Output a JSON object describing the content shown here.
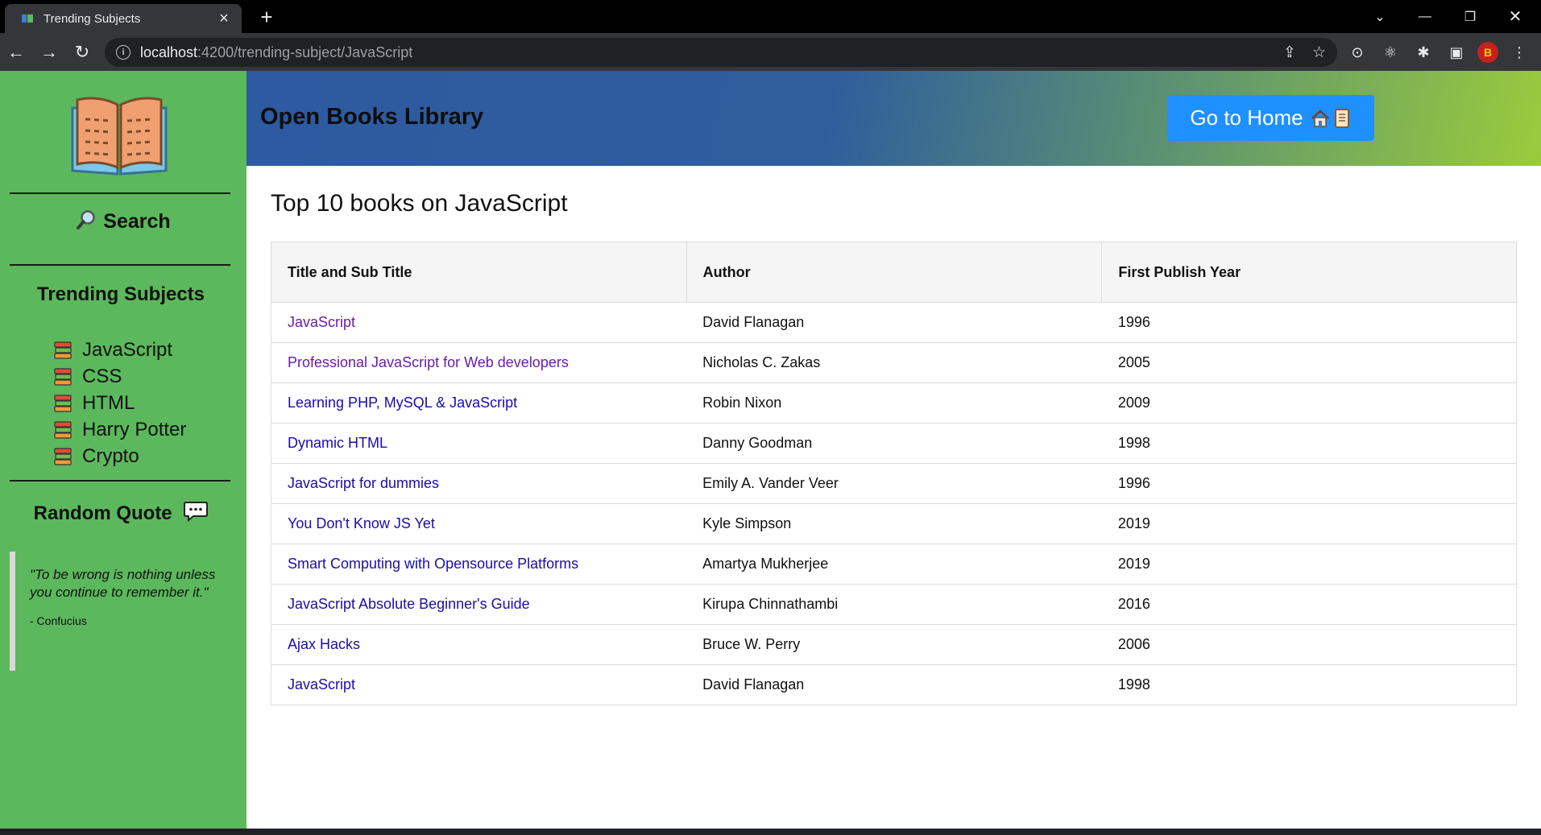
{
  "browser": {
    "tab_title": "Trending Subjects",
    "url_host": "localhost",
    "url_rest": ":4200/trending-subject/JavaScript"
  },
  "sidebar": {
    "search_label": "Search",
    "trending_heading": "Trending Subjects",
    "subjects": [
      "JavaScript",
      "CSS",
      "HTML",
      "Harry Potter",
      "Crypto"
    ],
    "quote_heading": "Random Quote",
    "quote_text": "\"To be wrong is nothing unless you continue to remember it.\"",
    "quote_author": "- Confucius"
  },
  "header": {
    "title": "Open Books Library",
    "home_button": "Go to Home"
  },
  "main": {
    "page_title": "Top 10 books on JavaScript",
    "columns": [
      "Title and Sub Title",
      "Author",
      "First Publish Year"
    ],
    "rows": [
      {
        "title": "JavaScript",
        "author": "David Flanagan",
        "year": "1996",
        "visited": true
      },
      {
        "title": "Professional JavaScript for Web developers",
        "author": "Nicholas C. Zakas",
        "year": "2005",
        "visited": true
      },
      {
        "title": "Learning PHP, MySQL & JavaScript",
        "author": "Robin Nixon",
        "year": "2009",
        "visited": false
      },
      {
        "title": "Dynamic HTML",
        "author": "Danny Goodman",
        "year": "1998",
        "visited": false
      },
      {
        "title": "JavaScript for dummies",
        "author": "Emily A. Vander Veer",
        "year": "1996",
        "visited": false
      },
      {
        "title": "You Don't Know JS Yet",
        "author": "Kyle Simpson",
        "year": "2019",
        "visited": false
      },
      {
        "title": "Smart Computing with Opensource Platforms",
        "author": "Amartya Mukherjee",
        "year": "2019",
        "visited": false
      },
      {
        "title": "JavaScript Absolute Beginner's Guide",
        "author": "Kirupa Chinnathambi",
        "year": "2016",
        "visited": false
      },
      {
        "title": "Ajax Hacks",
        "author": "Bruce W. Perry",
        "year": "2006",
        "visited": false
      },
      {
        "title": "JavaScript",
        "author": "David Flanagan",
        "year": "1998",
        "visited": false
      }
    ]
  },
  "colors": {
    "sidebar_bg": "#5cb85c",
    "header_gradient_start": "#2d5aa0",
    "header_gradient_end": "#9acb3c",
    "home_button_bg": "#1e90ff",
    "link": "#1a0dab",
    "link_visited": "#681da8"
  }
}
